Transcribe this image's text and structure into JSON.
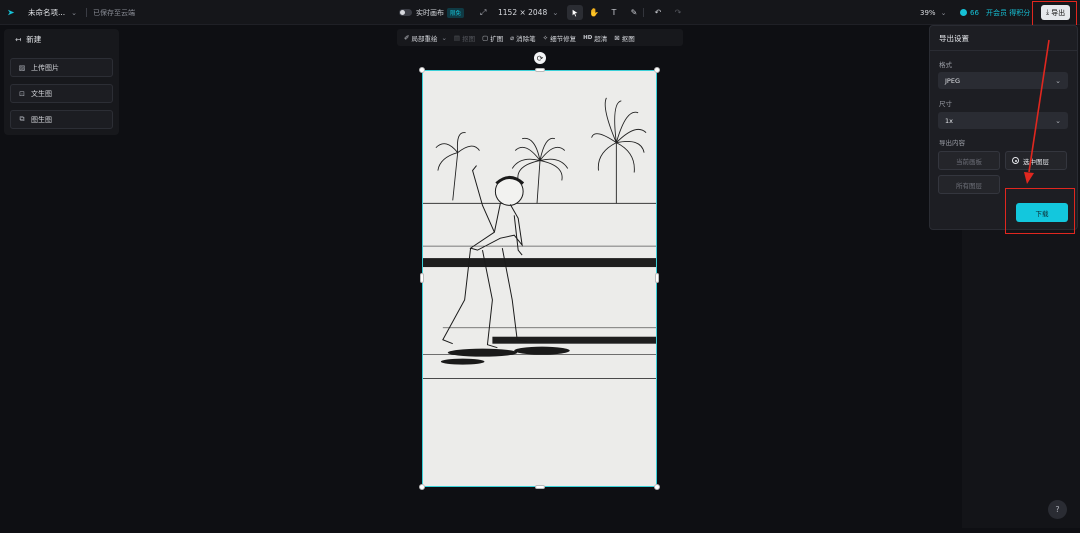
{
  "topbar": {
    "project_name": "未命名项...",
    "saved_status": "已保存至云端",
    "realtime_canvas_label": "实时画布",
    "realtime_badge": "限免",
    "canvas_size": "1152 × 2048",
    "zoom": "39%",
    "credits": "66",
    "vip_label": "开会员 得积分",
    "export_label": "导出"
  },
  "left_panel": {
    "new_label": "新建",
    "buttons": [
      {
        "label": "上传图片",
        "icon": "image-upload-icon"
      },
      {
        "label": "文生图",
        "icon": "text-to-image-icon"
      },
      {
        "label": "图生图",
        "icon": "image-to-image-icon"
      }
    ]
  },
  "context_toolbar": {
    "items": [
      {
        "label": "局部重绘",
        "icon": "inpaint-icon",
        "disabled": false
      },
      {
        "label": "抠图",
        "icon": "cutout-icon",
        "disabled": true
      },
      {
        "label": "扩图",
        "icon": "expand-icon",
        "disabled": false
      },
      {
        "label": "消除笔",
        "icon": "eraser-icon",
        "disabled": false
      },
      {
        "label": "细节修复",
        "icon": "detail-fix-icon",
        "disabled": false
      },
      {
        "label": "超清",
        "icon": "hd-icon",
        "disabled": false
      },
      {
        "label": "抠图",
        "icon": "cutout-icon",
        "disabled": false
      }
    ]
  },
  "export_panel": {
    "title": "导出设置",
    "format_label": "格式",
    "format_value": "JPEG",
    "size_label": "尺寸",
    "size_value": "1x",
    "content_label": "导出内容",
    "options": [
      {
        "label": "当前画板",
        "selected": false
      },
      {
        "label": "选中图层",
        "selected": true
      },
      {
        "label": "所有图层",
        "selected": false
      }
    ],
    "download_label": "下载"
  },
  "colors": {
    "accent": "#13c7dd",
    "annotation": "#e0271f",
    "background": "#0e0f13"
  }
}
